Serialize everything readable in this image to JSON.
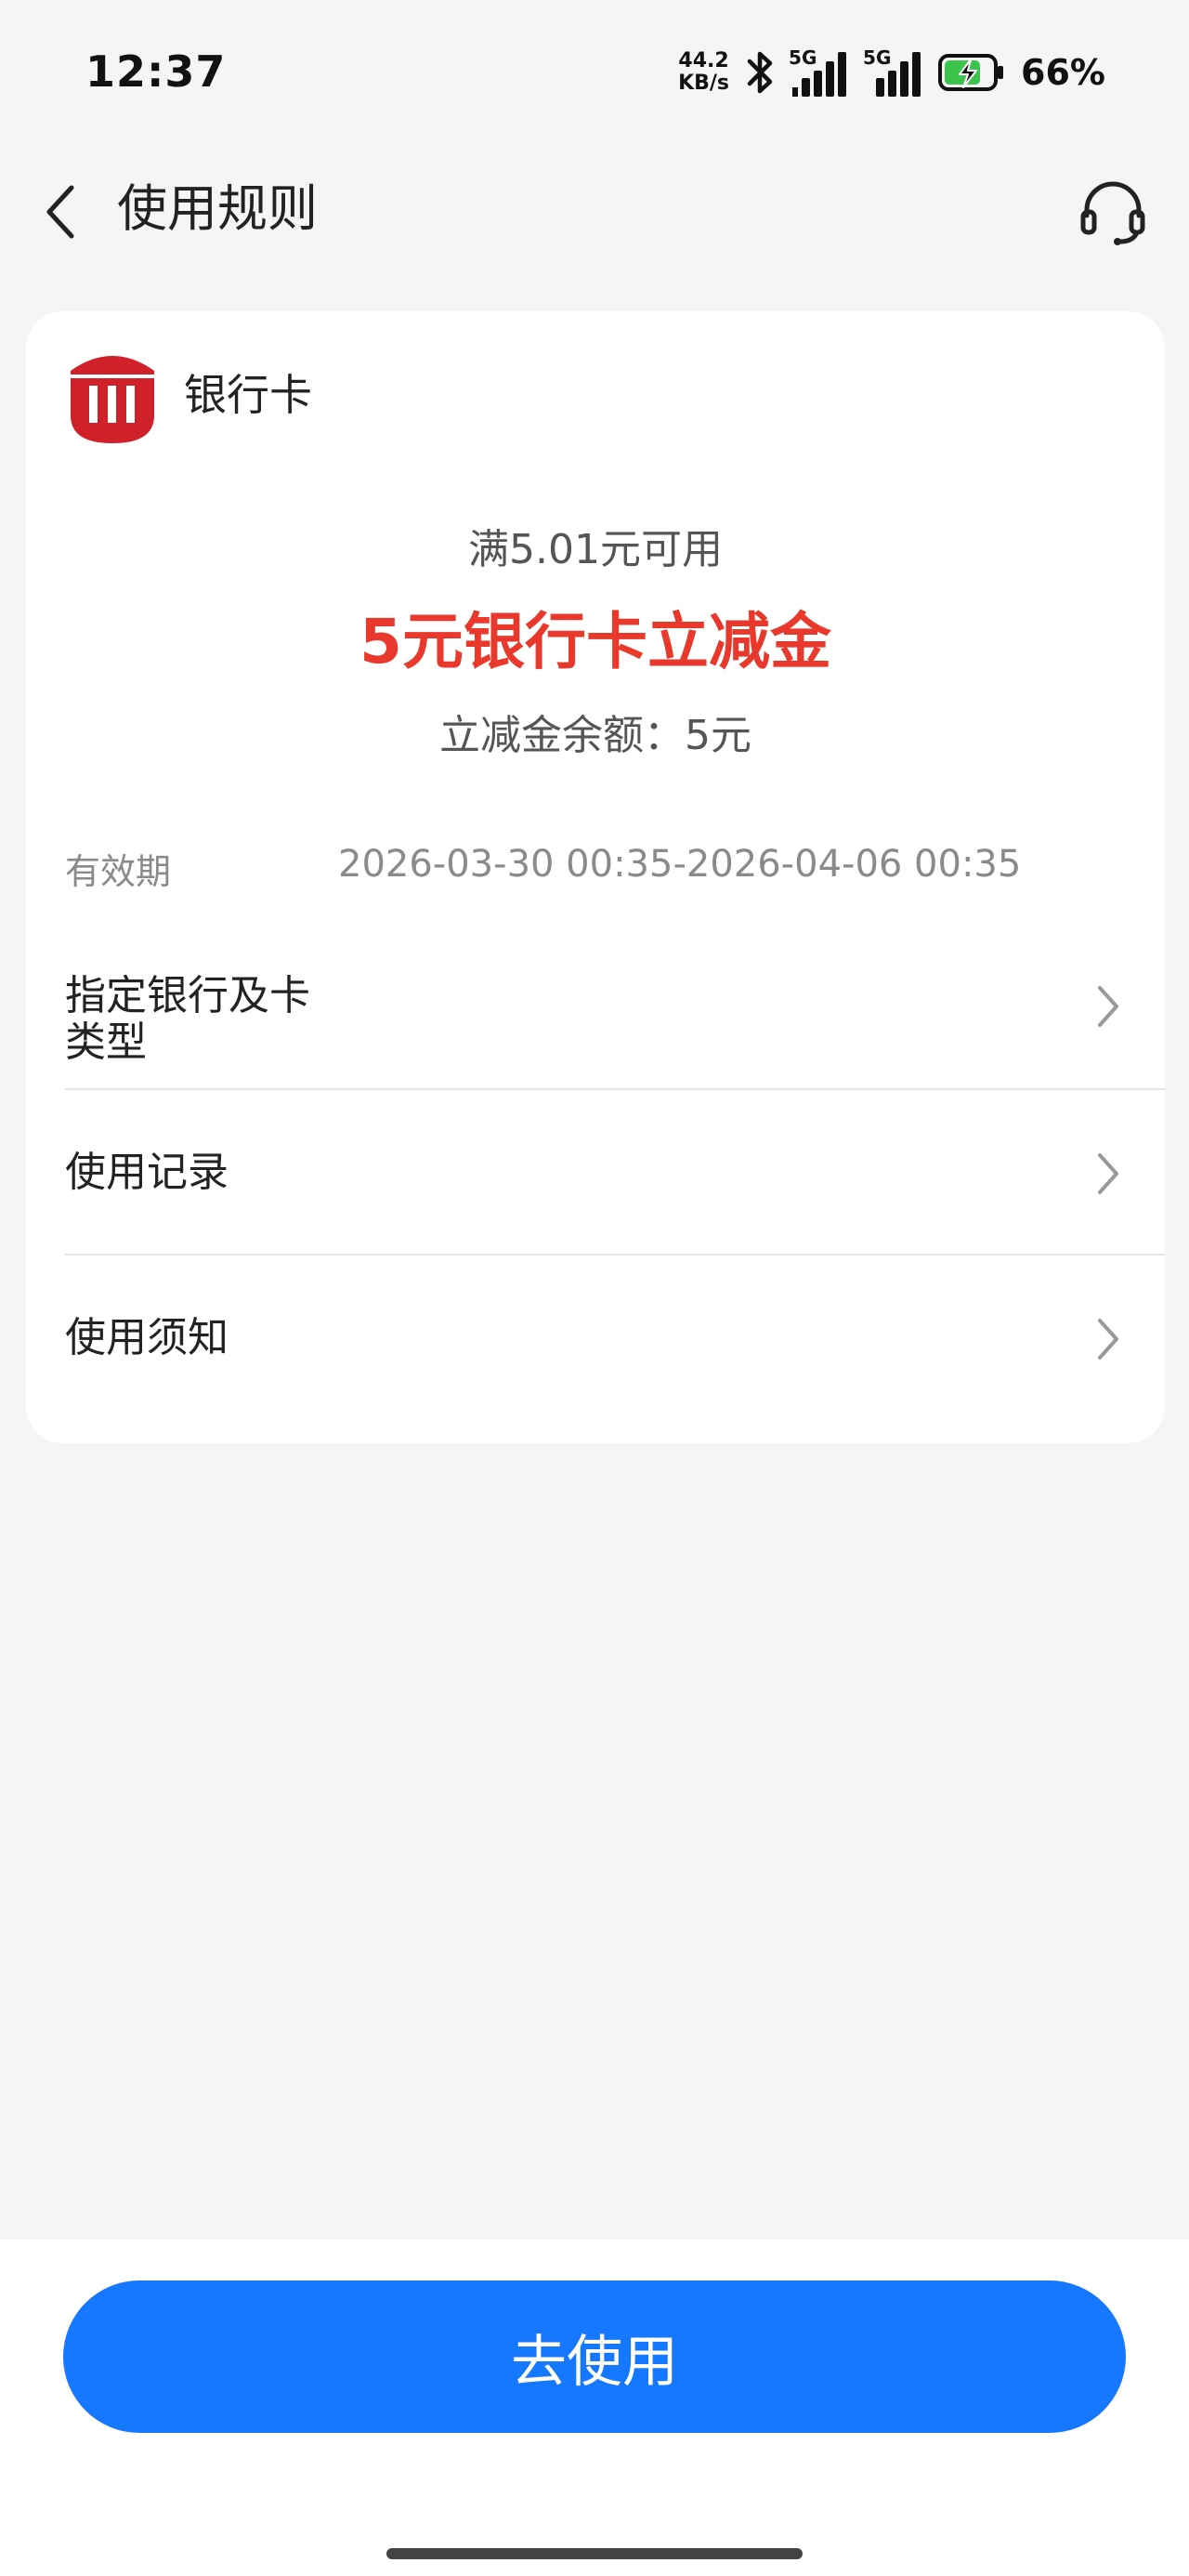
{
  "status_bar": {
    "time": "12:37",
    "net_speed_value": "44.2",
    "net_speed_unit": "KB/s",
    "signal1_label": "5G",
    "signal2_label": "5G",
    "battery_percent": "66%",
    "icons": [
      "bluetooth-icon",
      "signal-icon",
      "battery-charging-icon"
    ]
  },
  "header": {
    "title": "使用规则",
    "back_icon": "chevron-left-icon",
    "support_icon": "headset-icon"
  },
  "card": {
    "bank_label": "银行卡",
    "logo_icon": "bank-logo-icon",
    "threshold": "满5.01元可用",
    "coupon_name": "5元银行卡立减金",
    "balance": "立减金余额：5元",
    "validity_label": "有效期",
    "validity_value": "2026-03-30 00:35-2026-04-06 00:35",
    "rows": [
      {
        "label_line1": "指定银行及卡",
        "label_line2": "类型"
      },
      {
        "label": "使用记录"
      },
      {
        "label": "使用须知"
      }
    ]
  },
  "bottom": {
    "use_button_label": "去使用"
  },
  "colors": {
    "accent_blue": "#1677ff",
    "coupon_red": "#e8392c",
    "background": "#f5f5f5"
  }
}
